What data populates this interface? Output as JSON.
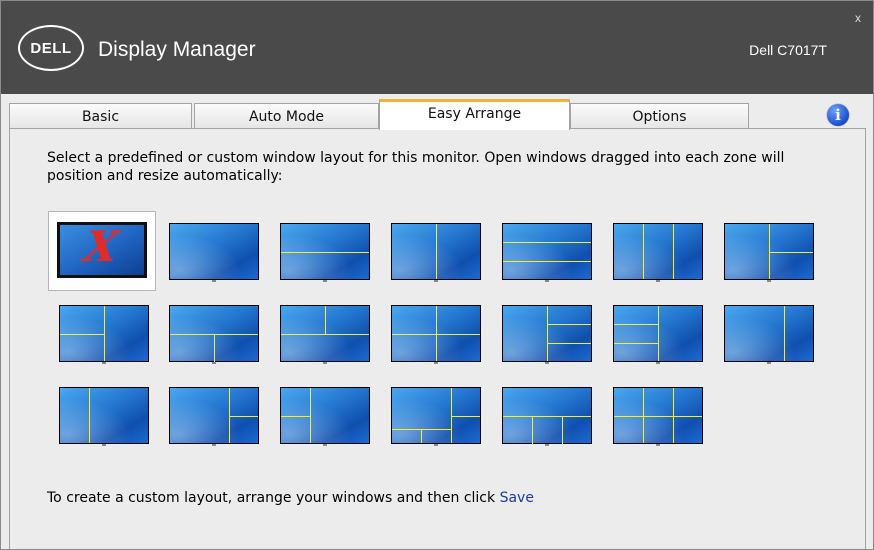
{
  "window": {
    "logo_text": "DELL",
    "title": "Display Manager",
    "model": "Dell C7017T",
    "close_label": "x"
  },
  "tabs": [
    {
      "label": "Basic",
      "active": false
    },
    {
      "label": "Auto Mode",
      "active": false
    },
    {
      "label": "Easy Arrange",
      "active": true
    },
    {
      "label": "Options",
      "active": false
    }
  ],
  "info_icon": "info-icon",
  "easy_arrange": {
    "instructions": "Select a predefined or custom window layout for this monitor.  Open windows dragged into each zone will position and resize automatically:",
    "selected_layout": "no-layout",
    "layouts": [
      {
        "name": "layout-none",
        "h": [],
        "v": []
      },
      {
        "name": "layout-full",
        "h": [],
        "v": []
      },
      {
        "name": "layout-2-stacked",
        "h": [
          [
            0.5,
            0,
            1
          ]
        ],
        "v": []
      },
      {
        "name": "layout-2-cols",
        "h": [],
        "v": [
          [
            0.5,
            0,
            1
          ]
        ]
      },
      {
        "name": "layout-3-stacked",
        "h": [
          [
            0.33,
            0,
            1
          ],
          [
            0.67,
            0,
            1
          ]
        ],
        "v": []
      },
      {
        "name": "layout-3-cols",
        "h": [],
        "v": [
          [
            0.33,
            0,
            1
          ],
          [
            0.67,
            0,
            1
          ]
        ]
      },
      {
        "name": "layout-left-right-split",
        "h": [
          [
            0.5,
            0.5,
            1
          ]
        ],
        "v": [
          [
            0.5,
            0,
            1
          ]
        ]
      },
      {
        "name": "layout-left-split-right",
        "h": [
          [
            0.5,
            0,
            0.5
          ]
        ],
        "v": [
          [
            0.5,
            0,
            1
          ]
        ]
      },
      {
        "name": "layout-top-bottom-split",
        "h": [
          [
            0.5,
            0,
            1
          ]
        ],
        "v": [
          [
            0.5,
            0.5,
            1
          ]
        ]
      },
      {
        "name": "layout-top-split-bottom",
        "h": [
          [
            0.5,
            0,
            1
          ]
        ],
        "v": [
          [
            0.5,
            0,
            0.5
          ]
        ]
      },
      {
        "name": "layout-quad",
        "h": [
          [
            0.5,
            0,
            1
          ]
        ],
        "v": [
          [
            0.5,
            0,
            1
          ]
        ]
      },
      {
        "name": "layout-left-3-right",
        "h": [
          [
            0.33,
            0.5,
            1
          ],
          [
            0.67,
            0.5,
            1
          ]
        ],
        "v": [
          [
            0.5,
            0,
            1
          ]
        ]
      },
      {
        "name": "layout-left3-right",
        "h": [
          [
            0.33,
            0,
            0.5
          ],
          [
            0.67,
            0,
            0.5
          ]
        ],
        "v": [
          [
            0.5,
            0,
            1
          ]
        ]
      },
      {
        "name": "layout-wide-narrow",
        "h": [],
        "v": [
          [
            0.67,
            0,
            1
          ]
        ]
      },
      {
        "name": "layout-narrow-wide",
        "h": [],
        "v": [
          [
            0.33,
            0,
            1
          ]
        ]
      },
      {
        "name": "layout-wide-narrow-split",
        "h": [
          [
            0.5,
            0.67,
            1
          ]
        ],
        "v": [
          [
            0.67,
            0,
            1
          ]
        ]
      },
      {
        "name": "layout-narrow-split-wide",
        "h": [
          [
            0.5,
            0,
            0.33
          ]
        ],
        "v": [
          [
            0.33,
            0,
            1
          ]
        ]
      },
      {
        "name": "layout-complex-a",
        "h": [
          [
            0.5,
            0.67,
            1
          ],
          [
            0.75,
            0,
            0.67
          ]
        ],
        "v": [
          [
            0.67,
            0,
            1
          ],
          [
            0.33,
            0.75,
            1
          ]
        ]
      },
      {
        "name": "layout-complex-b",
        "h": [
          [
            0.5,
            0,
            1
          ]
        ],
        "v": [
          [
            0.33,
            0.5,
            1
          ],
          [
            0.67,
            0.5,
            1
          ]
        ]
      },
      {
        "name": "layout-six-grid",
        "h": [
          [
            0.5,
            0,
            1
          ]
        ],
        "v": [
          [
            0.33,
            0,
            1
          ],
          [
            0.67,
            0,
            1
          ]
        ]
      }
    ]
  },
  "footer": {
    "text": "To create a custom layout, arrange your windows and then click ",
    "save_label": "Save"
  }
}
